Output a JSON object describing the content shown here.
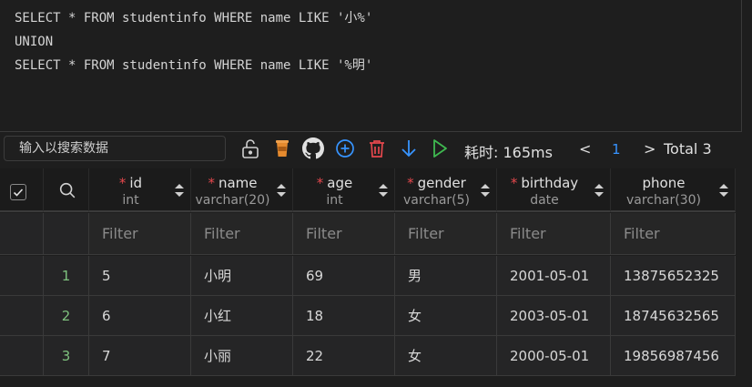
{
  "editor": {
    "lines": [
      "SELECT * FROM studentinfo WHERE name LIKE '小%'",
      "UNION",
      "SELECT * FROM studentinfo WHERE name LIKE '%明'"
    ]
  },
  "toolbar": {
    "search_placeholder": "输入以搜索数据",
    "elapsed_label": "耗时: 165ms",
    "page_prev": "<",
    "page_current": "1",
    "page_next": ">",
    "total_label": "Total 3",
    "icons": [
      "unlock-icon",
      "coffee-cup-icon",
      "github-icon",
      "add-circle-icon",
      "delete-icon",
      "download-arrow-icon",
      "run-play-icon"
    ]
  },
  "table": {
    "columns": [
      {
        "name": "id",
        "type": "int",
        "required": true
      },
      {
        "name": "name",
        "type": "varchar(20)",
        "required": true
      },
      {
        "name": "age",
        "type": "int",
        "required": true
      },
      {
        "name": "gender",
        "type": "varchar(5)",
        "required": true
      },
      {
        "name": "birthday",
        "type": "date",
        "required": true
      },
      {
        "name": "phone",
        "type": "varchar(30)",
        "required": false
      }
    ],
    "filter_placeholder": "Filter",
    "rows": [
      {
        "index": "1",
        "cells": [
          "5",
          "小明",
          "69",
          "男",
          "2001-05-01",
          "13875652325"
        ]
      },
      {
        "index": "2",
        "cells": [
          "6",
          "小红",
          "18",
          "女",
          "2003-05-01",
          "18745632565"
        ]
      },
      {
        "index": "3",
        "cells": [
          "7",
          "小丽",
          "22",
          "女",
          "2000-05-01",
          "19856987456"
        ]
      }
    ]
  },
  "colors": {
    "background": "#1e1e1e",
    "accent_blue": "#3794ff",
    "play_green": "#3fb950",
    "delete_red": "#e5484d",
    "coffee_orange": "#e58a2e",
    "index_green": "#7ec27e"
  }
}
